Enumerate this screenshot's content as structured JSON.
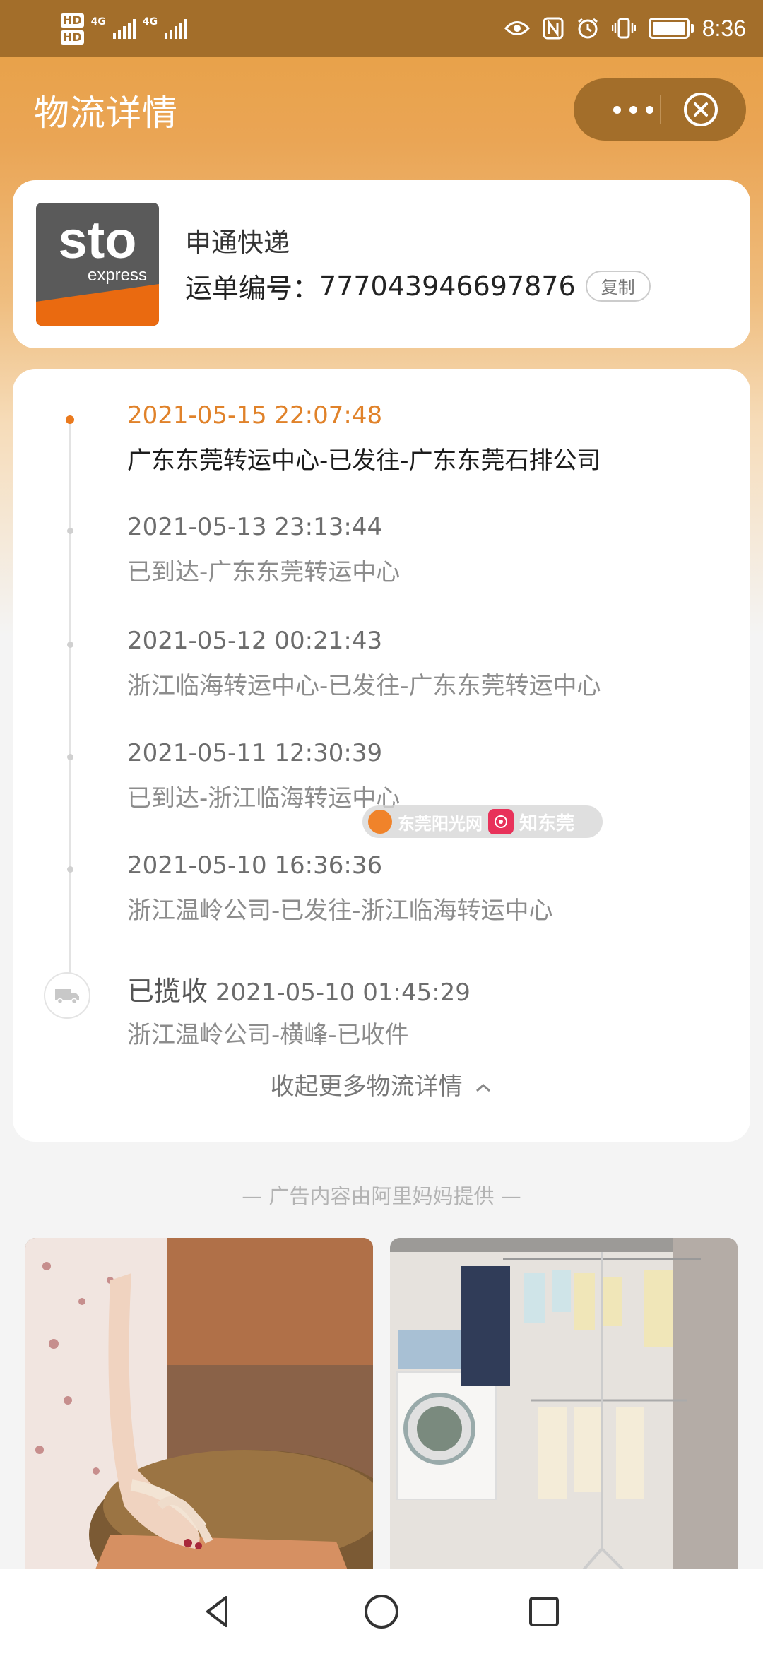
{
  "status_bar": {
    "hd1": "HD",
    "hd2": "HD",
    "net1": "4G",
    "net2": "4G",
    "time": "8:36"
  },
  "header": {
    "title": "物流详情",
    "more_icon": "more-dots-icon",
    "close_icon": "close-circle-icon"
  },
  "courier": {
    "logo_text": "sto",
    "logo_subtext": "express",
    "name": "申通快递",
    "waybill_label": "运单编号：",
    "waybill_number": "777043946697876",
    "copy_label": "复制"
  },
  "tracking": {
    "events": [
      {
        "time": "2021-05-15 22:07:48",
        "desc": "广东东莞转运中心-已发往-广东东莞石排公司"
      },
      {
        "time": "2021-05-13 23:13:44",
        "desc": "已到达-广东东莞转运中心"
      },
      {
        "time": "2021-05-12 00:21:43",
        "desc": "浙江临海转运中心-已发往-广东东莞转运中心"
      },
      {
        "time": "2021-05-11 12:30:39",
        "desc": "已到达-浙江临海转运中心"
      },
      {
        "time": "2021-05-10 16:36:36",
        "desc": "浙江温岭公司-已发往-浙江临海转运中心"
      }
    ],
    "collected": {
      "status": "已揽收",
      "time": "2021-05-10 01:45:29",
      "desc": "浙江温岭公司-横峰-已收件"
    },
    "collapse_label": "收起更多物流详情",
    "collapse_icon": "chevron-up-icon"
  },
  "watermark": {
    "text1": "东莞阳光网",
    "text2": "知东莞"
  },
  "ads": {
    "note": "— 广告内容由阿里妈妈提供 —"
  },
  "colors": {
    "status_bar": "#a36e2a",
    "header": "#e7a043",
    "accent": "#ea7a1e"
  }
}
